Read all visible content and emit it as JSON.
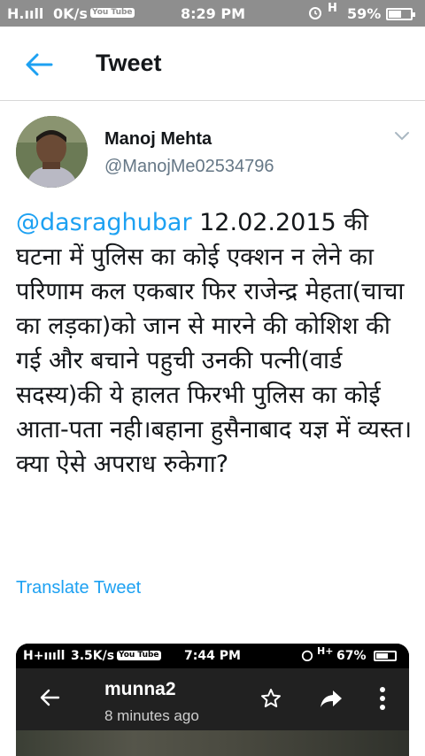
{
  "status_bar": {
    "signal": "H.ııll",
    "speed": "0K/s",
    "yt": "You Tube",
    "time": "8:29 PM",
    "network": "H",
    "battery": "59%",
    "battery_level": 0.59
  },
  "header": {
    "back_icon": "arrow-left-icon",
    "title": "Tweet"
  },
  "tweet": {
    "author_name": "Manoj Mehta",
    "author_handle": "@ManojMe02534796",
    "mention": "@dasraghubar",
    "text": " 12.02.2015 की घटना में पुलिस का कोई एक्शन न लेने का परिणाम कल एकबार फिर राजेन्द्र मेहता(चाचा का लड़का)को जान से मारने की कोशिश की गई और बचाने पहुची उनकी पत्नी(वार्ड सदस्य)की ये हालत फिरभी पुलिस का कोई आता-पता नही।बहाना हुसैनाबाद यज्ञ में व्यस्त।क्या ऐसे अपराध रुकेगा?",
    "translate_label": "Translate Tweet"
  },
  "media": {
    "status": {
      "signal": "H+ıııll",
      "speed": "3.5K/s",
      "yt": "You Tube",
      "time": "7:44 PM",
      "network": "H+",
      "battery": "67%",
      "battery_level": 0.67
    },
    "title": "munna2",
    "subtitle": "8 minutes ago",
    "icons": [
      "arrow-left-icon",
      "star-icon",
      "share-icon",
      "more-vertical-icon"
    ]
  },
  "colors": {
    "accent": "#1da1f2",
    "status_bar": "#8e8e8e",
    "text": "#14171a",
    "secondary_text": "#657786"
  }
}
